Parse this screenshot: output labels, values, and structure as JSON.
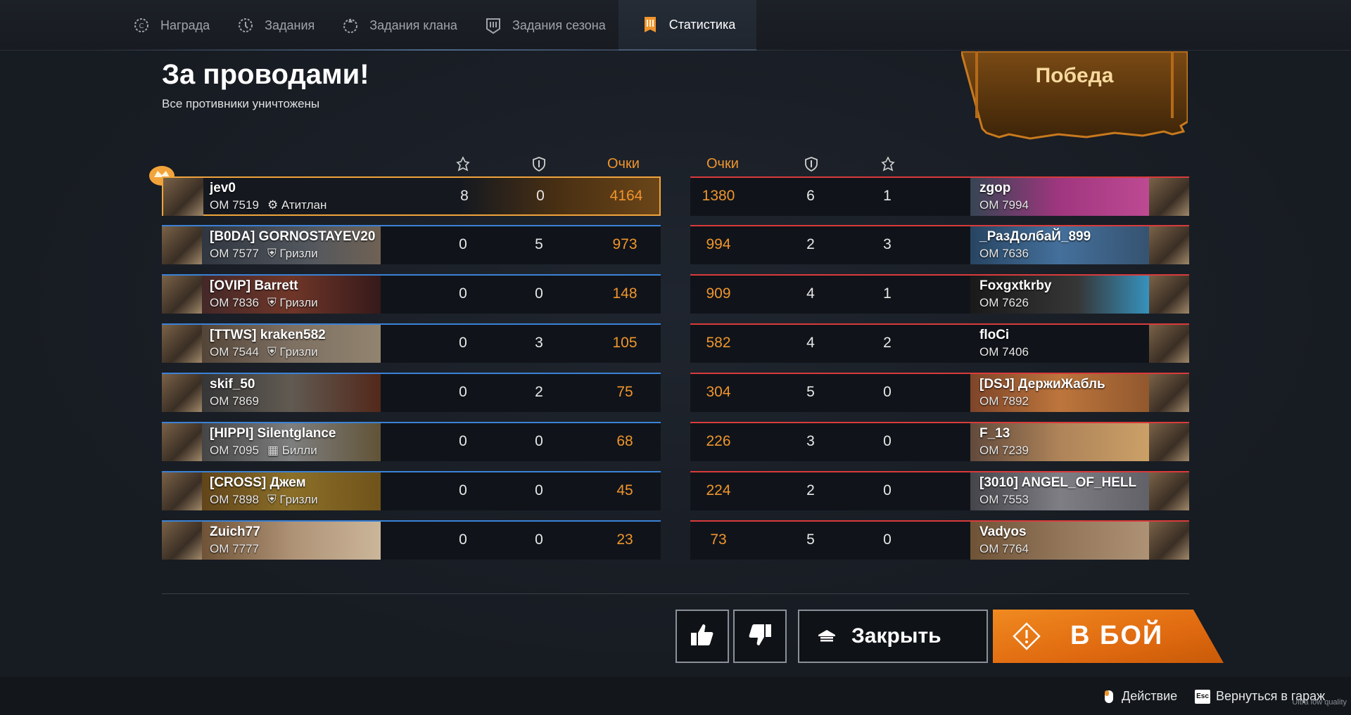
{
  "tabs": [
    {
      "label": "Награда",
      "icon": "reward-icon"
    },
    {
      "label": "Задания",
      "icon": "tasks-icon"
    },
    {
      "label": "Задания клана",
      "icon": "clan-tasks-icon"
    },
    {
      "label": "Задания сезона",
      "icon": "season-tasks-icon"
    },
    {
      "label": "Статистика",
      "icon": "statistics-icon"
    }
  ],
  "battle": {
    "title": "За проводами!",
    "subtitle": "Все противники уничтожены",
    "result": "Победа"
  },
  "headers": {
    "score_left": "Очки",
    "score_right": "Очки"
  },
  "team_left": [
    {
      "name": "jev0",
      "om": "ОМ 7519",
      "clan": "Атитлан",
      "kills": "8",
      "assists": "0",
      "score": "4164"
    },
    {
      "name": "[B0DA] GORNOSTAYEV20",
      "om": "ОМ 7577",
      "clan": "Гризли",
      "kills": "0",
      "assists": "5",
      "score": "973"
    },
    {
      "name": "[OVIP] Barrett",
      "om": "ОМ 7836",
      "clan": "Гризли",
      "kills": "0",
      "assists": "0",
      "score": "148"
    },
    {
      "name": "[TTWS] kraken582",
      "om": "ОМ 7544",
      "clan": "Гризли",
      "kills": "0",
      "assists": "3",
      "score": "105"
    },
    {
      "name": "skif_50",
      "om": "ОМ 7869",
      "clan": "",
      "kills": "0",
      "assists": "2",
      "score": "75"
    },
    {
      "name": "[HIPPI] Silentglance",
      "om": "ОМ 7095",
      "clan": "Билли",
      "kills": "0",
      "assists": "0",
      "score": "68"
    },
    {
      "name": "[CROSS] Джем",
      "om": "ОМ 7898",
      "clan": "Гризли",
      "kills": "0",
      "assists": "0",
      "score": "45"
    },
    {
      "name": "Zuich77",
      "om": "ОМ 7777",
      "clan": "",
      "kills": "0",
      "assists": "0",
      "score": "23"
    }
  ],
  "team_right": [
    {
      "name": "zgop",
      "om": "ОМ 7994",
      "score": "1380",
      "assists": "6",
      "kills": "1"
    },
    {
      "name": "_РазДолбаЙ_899",
      "om": "ОМ 7636",
      "score": "994",
      "assists": "2",
      "kills": "3"
    },
    {
      "name": "Foxgxtkrby",
      "om": "ОМ 7626",
      "score": "909",
      "assists": "4",
      "kills": "1"
    },
    {
      "name": "floCi",
      "om": "ОМ 7406",
      "score": "582",
      "assists": "4",
      "kills": "2"
    },
    {
      "name": "[DSJ] ДержиЖабль",
      "om": "ОМ 7892",
      "score": "304",
      "assists": "5",
      "kills": "0"
    },
    {
      "name": "F_13",
      "om": "ОМ 7239",
      "score": "226",
      "assists": "3",
      "kills": "0"
    },
    {
      "name": "[3010] ANGEL_OF_HELL",
      "om": "ОМ 7553",
      "score": "224",
      "assists": "2",
      "kills": "0"
    },
    {
      "name": "Vadyos",
      "om": "ОМ 7764",
      "score": "73",
      "assists": "5",
      "kills": "0"
    }
  ],
  "buttons": {
    "close": "Закрыть",
    "battle": "В БОЙ"
  },
  "footer": {
    "action": "Действие",
    "back": "Вернуться в гараж",
    "esc_key": "Esc",
    "quality": "Ultra low quality"
  },
  "colors": {
    "accent": "#f0952c",
    "ally": "#3b82d6",
    "enemy": "#d93b3b"
  }
}
